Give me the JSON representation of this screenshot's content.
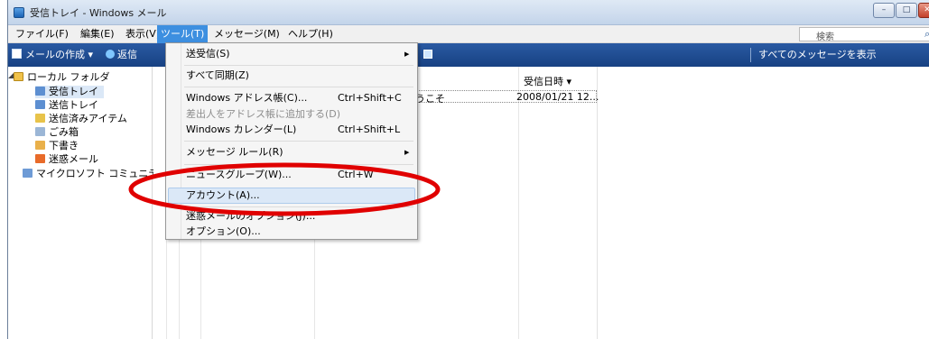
{
  "window": {
    "title": "受信トレイ - Windows メール",
    "buttons": {
      "minimize": "–",
      "maximize": "□",
      "close": "✕"
    }
  },
  "menubar": {
    "file": "ファイル(F)",
    "edit": "編集(E)",
    "view": "表示(V)",
    "tools": "ツール(T)",
    "message": "メッセージ(M)",
    "help": "ヘルプ(H)",
    "search_placeholder": "検索",
    "search_icon": "magnifier"
  },
  "toolbar": {
    "new_mail": "メールの作成 ▾",
    "reply": "返信",
    "view_filter": "すべてのメッセージを表示"
  },
  "folders": {
    "local": "ローカル フォルダ",
    "inbox": "受信トレイ",
    "outbox": "送信トレイ",
    "sent": "送信済みアイテム",
    "trash": "ごみ箱",
    "drafts": "下書き",
    "junk": "迷惑メール",
    "community": "マイクロソフト コミュニテ"
  },
  "message_list": {
    "date_header": "受信日時 ▾",
    "row_subject": "うこそ",
    "row_date": "2008/01/21 12..."
  },
  "tools_menu": {
    "items": [
      "送受信(S)",
      "すべて同期(Z)",
      "Windows アドレス帳(C)...",
      "差出人をアドレス帳に追加する(D)",
      "Windows カレンダー(L)",
      "メッセージ ルール(R)",
      "ニュースグループ(W)...",
      "アカウント(A)...",
      "迷惑メールのオプション(J)...",
      "オプション(O)..."
    ],
    "shortcuts": {
      "address_book": "Ctrl+Shift+C",
      "calendar": "Ctrl+Shift+L",
      "newsgroups": "Ctrl+W"
    },
    "highlighted": "アカウント(A)..."
  },
  "colors": {
    "toolbar_blue": "#174182",
    "menu_highlight": "#3d8fe0",
    "annotation_red": "#e00000"
  }
}
